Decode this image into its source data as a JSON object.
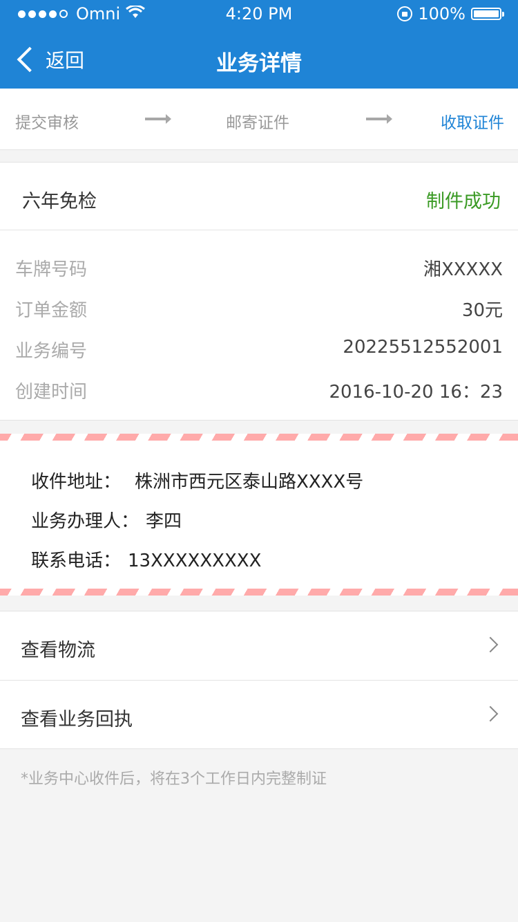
{
  "status_bar": {
    "carrier": "Omni",
    "time": "4:20 PM",
    "battery": "100%"
  },
  "nav": {
    "back_label": "返回",
    "title": "业务详情"
  },
  "steps": [
    {
      "label": "提交审核",
      "active": false
    },
    {
      "label": "邮寄证件",
      "active": false
    },
    {
      "label": "收取证件",
      "active": true
    }
  ],
  "service": {
    "name": "六年免检",
    "status": "制件成功"
  },
  "details": [
    {
      "label": "车牌号码",
      "value": "湘XXXXX"
    },
    {
      "label": "订单金额",
      "value": "30元"
    },
    {
      "label": "业务编号",
      "value": "20225512552001"
    },
    {
      "label": "创建时间",
      "value": "2016-10-20 16：23"
    }
  ],
  "address": [
    {
      "label": "收件地址：",
      "value": "株洲市西元区泰山路XXXX号"
    },
    {
      "label": "业务办理人：",
      "value": "李四"
    },
    {
      "label": "联系电话：",
      "value": "13XXXXXXXXX"
    }
  ],
  "links": [
    {
      "label": "查看物流"
    },
    {
      "label": "查看业务回执"
    }
  ],
  "note": "*业务中心收件后，将在3个工作日内完整制证",
  "colors": {
    "header": "#1f84d6",
    "step_active": "#1f84d6",
    "status_success": "#3a9a24",
    "stripe": "#ffaaaa"
  }
}
